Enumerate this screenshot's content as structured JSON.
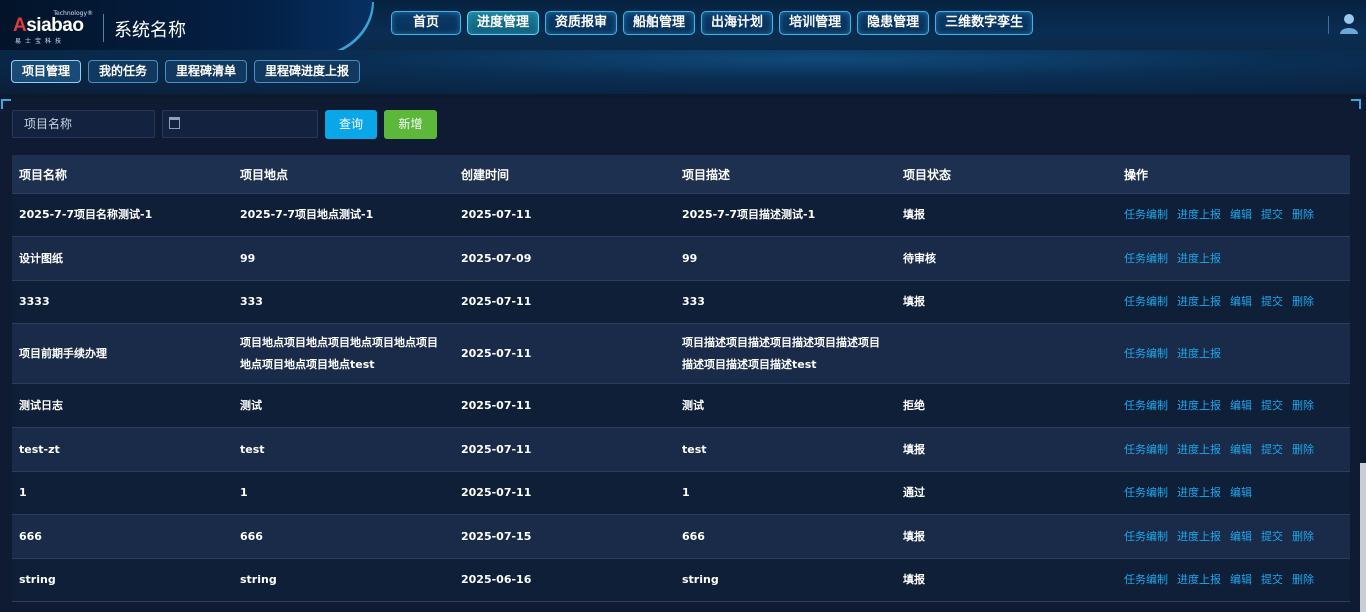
{
  "header": {
    "logo_text": "Asiabao",
    "logo_tech": "Technology®",
    "logo_sub": "易士宝科技",
    "system_name": "系统名称",
    "nav": [
      {
        "label": "首页"
      },
      {
        "label": "进度管理"
      },
      {
        "label": "资质报审"
      },
      {
        "label": "船舶管理"
      },
      {
        "label": "出海计划"
      },
      {
        "label": "培训管理"
      },
      {
        "label": "隐患管理"
      },
      {
        "label": "三维数字孪生"
      }
    ],
    "active_nav": "进度管理"
  },
  "subnav": [
    {
      "label": "项目管理"
    },
    {
      "label": "我的任务"
    },
    {
      "label": "里程碑清单"
    },
    {
      "label": "里程碑进度上报"
    }
  ],
  "filters": {
    "name_placeholder": "项目名称",
    "date_placeholder": "",
    "query_label": "查询",
    "add_label": "新增"
  },
  "table": {
    "columns": [
      "项目名称",
      "项目地点",
      "创建时间",
      "项目描述",
      "项目状态",
      "操作"
    ],
    "rows": [
      {
        "name": "2025-7-7项目名称测试-1",
        "location": "2025-7-7项目地点测试-1",
        "created": "2025-07-11",
        "desc": "2025-7-7项目描述测试-1",
        "status": "填报",
        "actions": [
          "任务编制",
          "进度上报",
          "编辑",
          "提交",
          "删除"
        ]
      },
      {
        "name": "设计图纸",
        "location": "99",
        "created": "2025-07-09",
        "desc": "99",
        "status": "待审核",
        "actions": [
          "任务编制",
          "进度上报"
        ]
      },
      {
        "name": "3333",
        "location": "333",
        "created": "2025-07-11",
        "desc": "333",
        "status": "填报",
        "actions": [
          "任务编制",
          "进度上报",
          "编辑",
          "提交",
          "删除"
        ]
      },
      {
        "name": "项目前期手续办理",
        "location": "项目地点项目地点项目地点项目地点项目地点项目地点项目地点test",
        "created": "2025-07-11",
        "desc": "项目描述项目描述项目描述项目描述项目描述项目描述项目描述test",
        "status": "",
        "actions": [
          "任务编制",
          "进度上报"
        ]
      },
      {
        "name": "测试日志",
        "location": "测试",
        "created": "2025-07-11",
        "desc": "测试",
        "status": "拒绝",
        "actions": [
          "任务编制",
          "进度上报",
          "编辑",
          "提交",
          "删除"
        ]
      },
      {
        "name": "test-zt",
        "location": "test",
        "created": "2025-07-11",
        "desc": "test",
        "status": "填报",
        "actions": [
          "任务编制",
          "进度上报",
          "编辑",
          "提交",
          "删除"
        ]
      },
      {
        "name": "1",
        "location": "1",
        "created": "2025-07-11",
        "desc": "1",
        "status": "通过",
        "actions": [
          "任务编制",
          "进度上报",
          "编辑"
        ]
      },
      {
        "name": "666",
        "location": "666",
        "created": "2025-07-15",
        "desc": "666",
        "status": "填报",
        "actions": [
          "任务编制",
          "进度上报",
          "编辑",
          "提交",
          "删除"
        ]
      },
      {
        "name": "string",
        "location": "string",
        "created": "2025-06-16",
        "desc": "string",
        "status": "填报",
        "actions": [
          "任务编制",
          "进度上报",
          "编辑",
          "提交",
          "删除"
        ]
      }
    ]
  },
  "colors": {
    "accent": "#0aa7e8",
    "add": "#5cb83a",
    "link": "#1ea7ee"
  }
}
